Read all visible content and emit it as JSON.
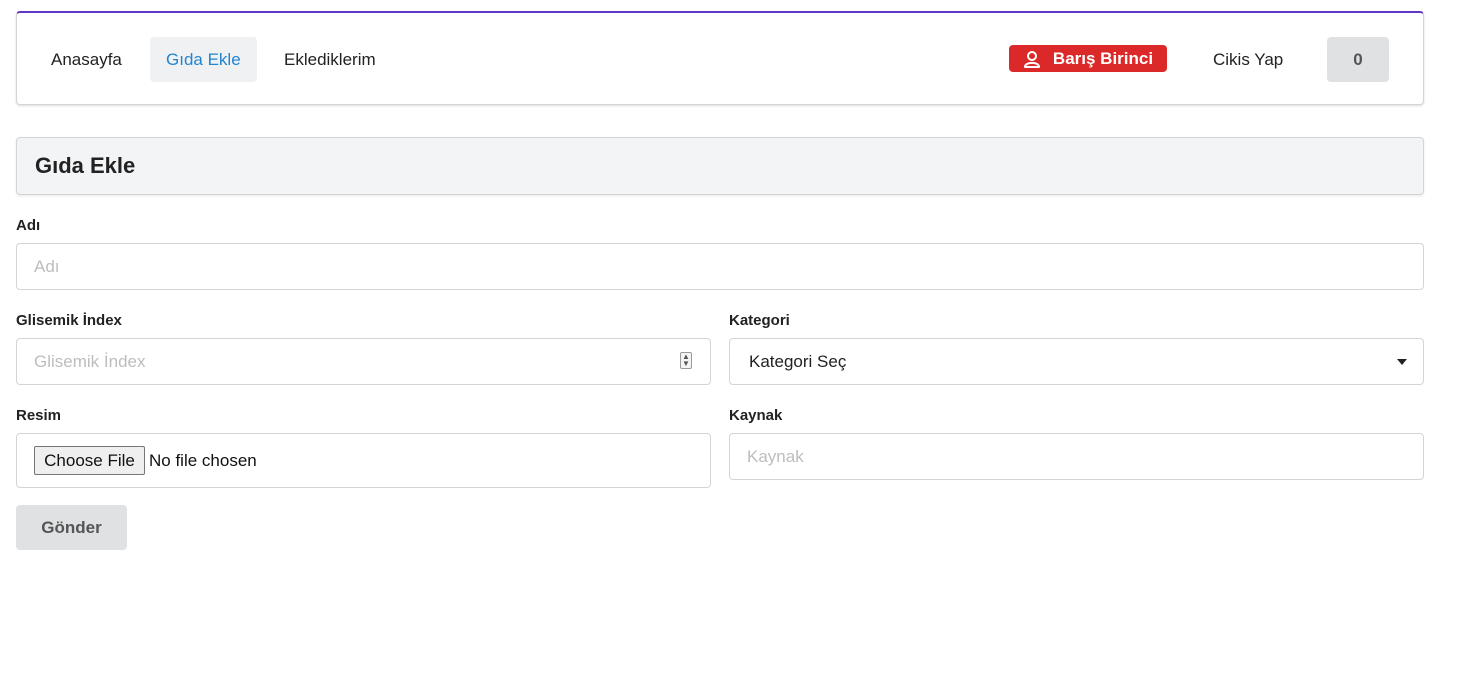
{
  "nav": {
    "items": [
      {
        "label": "Anasayfa"
      },
      {
        "label": "Gıda Ekle"
      },
      {
        "label": "Eklediklerim"
      }
    ],
    "user_name": "Barış Birinci",
    "logout_label": "Cikis Yap",
    "counter": "0"
  },
  "page_title": "Gıda Ekle",
  "form": {
    "name": {
      "label": "Adı",
      "placeholder": "Adı"
    },
    "glycemic": {
      "label": "Glisemik İndex",
      "placeholder": "Glisemik İndex"
    },
    "category": {
      "label": "Kategori",
      "selected": "Kategori Seç"
    },
    "image": {
      "label": "Resim",
      "button": "Choose File",
      "status": "No file chosen"
    },
    "source": {
      "label": "Kaynak",
      "placeholder": "Kaynak"
    },
    "submit_label": "Gönder"
  },
  "colors": {
    "accent_border": "#6435c9",
    "active_link": "#2185d0",
    "user_badge": "#db2828"
  }
}
